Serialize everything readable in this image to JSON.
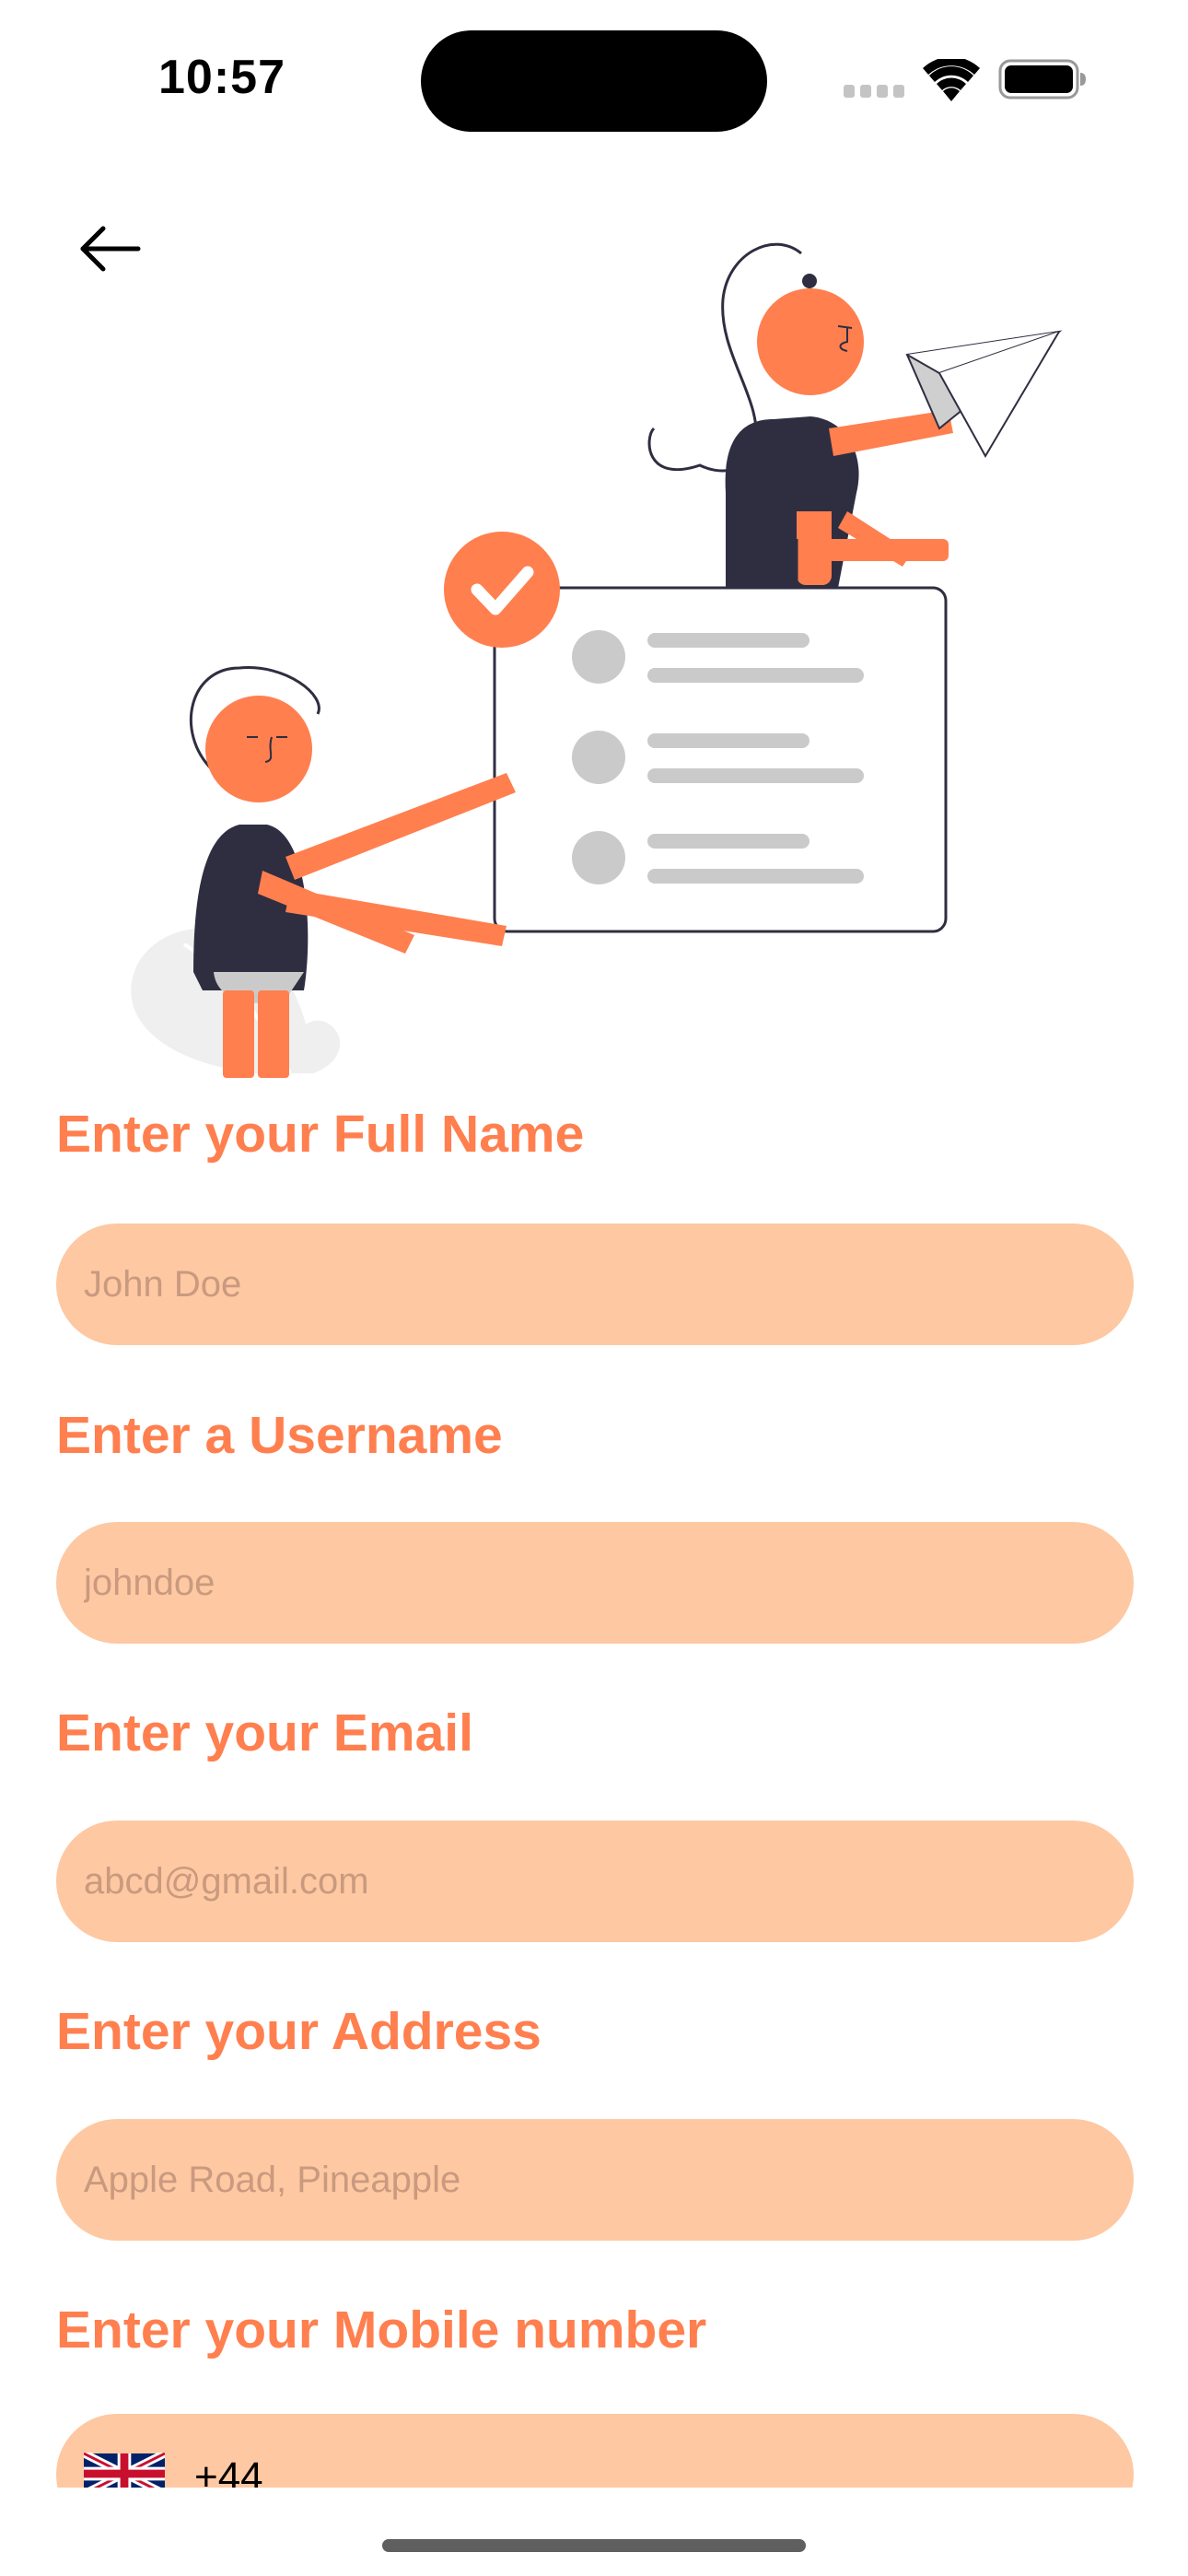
{
  "status_bar": {
    "time": "10:57"
  },
  "icons": {
    "back": "arrow-left-icon",
    "signal": "cellular-signal-icon",
    "wifi": "wifi-icon",
    "battery": "battery-icon",
    "flag": "uk-flag-icon"
  },
  "colors": {
    "accent": "#FF7F4F",
    "field_background": "#FEC8A2",
    "placeholder": "#C99A7F",
    "illustration_dark": "#2F2E41",
    "illustration_gray": "#CACACA"
  },
  "form": {
    "full_name": {
      "label": "Enter your Full Name",
      "placeholder": "John Doe"
    },
    "username": {
      "label": "Enter a Username",
      "placeholder": "johndoe"
    },
    "email": {
      "label": "Enter your Email",
      "placeholder": "abcd@gmail.com"
    },
    "address": {
      "label": "Enter your Address",
      "placeholder": "Apple Road, Pineapple"
    },
    "mobile": {
      "label": "Enter your Mobile number",
      "country_code": "+44"
    }
  }
}
